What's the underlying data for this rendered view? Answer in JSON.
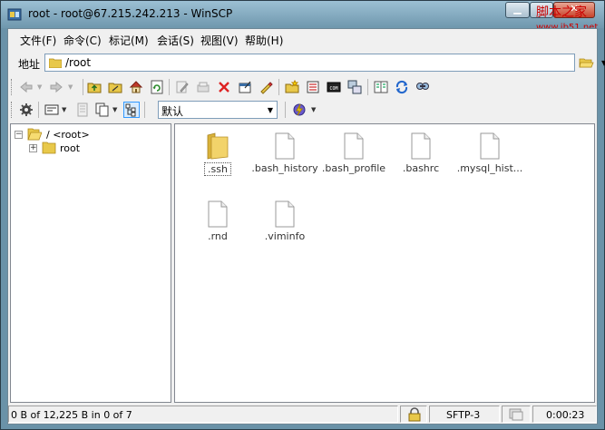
{
  "window": {
    "title": "root - root@67.215.242.213 - WinSCP",
    "watermark": "脚本之家",
    "watermark_url": "www.jb51.net"
  },
  "menu": [
    {
      "label": "文件(F)"
    },
    {
      "label": "命令(C)"
    },
    {
      "label": "标记(M)"
    },
    {
      "label": "会话(S)"
    },
    {
      "label": "视图(V)"
    },
    {
      "label": "帮助(H)"
    }
  ],
  "address": {
    "label": "地址",
    "path": "/root"
  },
  "toolbar2": {
    "session_combo_value": "默认"
  },
  "tree": {
    "root_label": "/ <root>",
    "child_label": "root"
  },
  "files": [
    {
      "name": ".ssh",
      "type": "folder",
      "selected": true
    },
    {
      "name": ".bash_history",
      "type": "file"
    },
    {
      "name": ".bash_profile",
      "type": "file"
    },
    {
      "name": ".bashrc",
      "type": "file"
    },
    {
      "name": ".mysql_hist...",
      "type": "file"
    },
    {
      "name": ".rnd",
      "type": "file"
    },
    {
      "name": ".viminfo",
      "type": "file"
    }
  ],
  "status": {
    "selection": "0 B of 12,225 B in 0 of 7",
    "protocol": "SFTP-3",
    "elapsed": "0:00:23"
  },
  "colors": {
    "title_gradient_top": "#9cc0d4",
    "folder_yellow": "#e8c84a",
    "close_red": "#c8442b"
  }
}
